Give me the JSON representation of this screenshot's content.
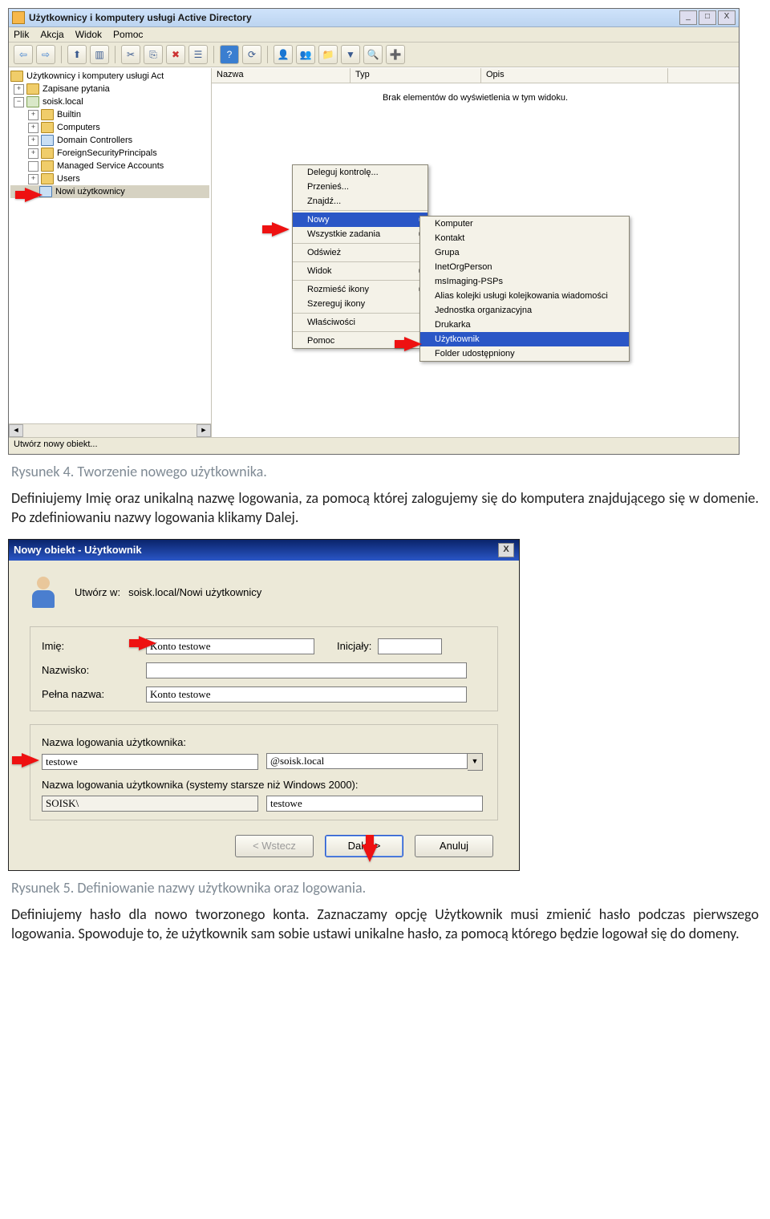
{
  "screenshot1": {
    "window_title": "Użytkownicy i komputery usługi Active Directory",
    "win_btns": {
      "min": "_",
      "max": "□",
      "close": "X"
    },
    "menu": [
      "Plik",
      "Akcja",
      "Widok",
      "Pomoc"
    ],
    "tree": {
      "root": "Użytkownicy i komputery usługi Act",
      "saved_queries": "Zapisane pytania",
      "domain": "soisk.local",
      "children": [
        "Builtin",
        "Computers",
        "Domain Controllers",
        "ForeignSecurityPrincipals",
        "Managed Service Accounts",
        "Users"
      ],
      "selected": "Nowi użytkownicy"
    },
    "columns": [
      "Nazwa",
      "Typ",
      "Opis"
    ],
    "empty_text": "Brak elementów do wyświetlenia w tym widoku.",
    "context_menu": {
      "items_top": [
        "Deleguj kontrolę...",
        "Przenieś...",
        "Znajdź..."
      ],
      "nowy": "Nowy",
      "tasks": "Wszystkie zadania",
      "refresh": "Odśwież",
      "view": "Widok",
      "arrange": "Rozmieść ikony",
      "sort": "Szereguj ikony",
      "props": "Właściwości",
      "help": "Pomoc"
    },
    "submenu": {
      "items": [
        "Komputer",
        "Kontakt",
        "Grupa",
        "InetOrgPerson",
        "msImaging-PSPs",
        "Alias kolejki usługi kolejkowania wiadomości",
        "Jednostka organizacyjna",
        "Drukarka"
      ],
      "highlight": "Użytkownik",
      "after": "Folder udostępniony"
    },
    "status": "Utwórz nowy obiekt..."
  },
  "caption1": "Rysunek 4. Tworzenie nowego użytkownika.",
  "para1": "Definiujemy Imię oraz unikalną nazwę logowania, za pomocą której zalogujemy się do komputera znajdującego się w domenie. Po zdefiniowaniu nazwy logowania klikamy Dalej.",
  "dialog": {
    "title": "Nowy obiekt - Użytkownik",
    "close": "X",
    "create_in_lbl": "Utwórz w:",
    "create_in_val": "soisk.local/Nowi użytkownicy",
    "labels": {
      "first": "Imię:",
      "initials": "Inicjały:",
      "last": "Nazwisko:",
      "full": "Pełna nazwa:",
      "logon": "Nazwa logowania użytkownika:",
      "logon_pre2000": "Nazwa logowania użytkownika (systemy starsze niż Windows 2000):"
    },
    "values": {
      "first": "Konto testowe",
      "initials": "",
      "last": "",
      "full": "Konto testowe",
      "logon": "testowe",
      "domain_suffix": "@soisk.local",
      "netbios": "SOISK\\",
      "sam": "testowe"
    },
    "buttons": {
      "back": "< Wstecz",
      "next": "Dalej >",
      "cancel": "Anuluj"
    }
  },
  "caption2": "Rysunek 5. Definiowanie nazwy użytkownika oraz logowania.",
  "para2": "Definiujemy hasło dla nowo tworzonego konta. Zaznaczamy opcję Użytkownik musi zmienić hasło podczas pierwszego logowania. Spowoduje to, że użytkownik sam sobie ustawi unikalne hasło, za pomocą którego będzie logował się do domeny."
}
